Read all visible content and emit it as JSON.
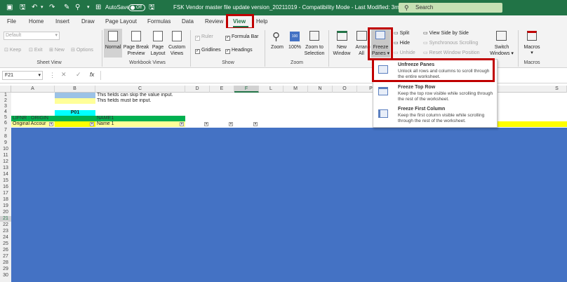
{
  "titlebar": {
    "autosave_label": "AutoSave",
    "autosave_state": "Off",
    "document_title": "FSK Vendor master file update version_20211019  -  Compatibility Mode  -  Last Modified: 3m ago",
    "search_placeholder": "Search",
    "accent_color": "#217346"
  },
  "tabs": [
    "File",
    "Home",
    "Insert",
    "Draw",
    "Page Layout",
    "Formulas",
    "Data",
    "Review",
    "View",
    "Help"
  ],
  "active_tab": "View",
  "ribbon": {
    "sheet_view": {
      "dropdown_value": "Default",
      "keep": "Keep",
      "exit": "Exit",
      "new": "New",
      "options": "Options",
      "label": "Sheet View"
    },
    "workbook_views": {
      "normal": "Normal",
      "page_break_1": "Page Break",
      "page_break_2": "Preview",
      "page_layout_1": "Page",
      "page_layout_2": "Layout",
      "custom_views_1": "Custom",
      "custom_views_2": "Views",
      "label": "Workbook Views"
    },
    "show": {
      "ruler": "Ruler",
      "formula_bar": "Formula Bar",
      "gridlines": "Gridlines",
      "headings": "Headings",
      "label": "Show"
    },
    "zoom": {
      "zoom": "Zoom",
      "hundred": "100%",
      "zoom_to_sel_1": "Zoom to",
      "zoom_to_sel_2": "Selection",
      "label": "Zoom"
    },
    "window": {
      "new_window_1": "New",
      "new_window_2": "Window",
      "arrange_1": "Arrange",
      "arrange_2": "All",
      "freeze_1": "Freeze",
      "freeze_2": "Panes ▾",
      "split": "Split",
      "hide": "Hide",
      "unhide": "Unhide",
      "side_by_side": "View Side by Side",
      "sync_scroll": "Synchronous Scrolling",
      "reset_pos": "Reset Window Position",
      "switch_1": "Switch",
      "switch_2": "Windows ▾"
    },
    "macros": {
      "macros": "Macros",
      "label": "Macros"
    }
  },
  "formula_bar": {
    "name_box": "F21",
    "fx": "fx",
    "content": ""
  },
  "columns": [
    "A",
    "B",
    "C",
    "D",
    "E",
    "F",
    "L",
    "M",
    "N",
    "O",
    "P",
    "S"
  ],
  "rows": [
    "1",
    "2",
    "3",
    "4",
    "5",
    "6",
    "7",
    "8",
    "9",
    "10",
    "11",
    "12",
    "13",
    "14",
    "15",
    "16",
    "17",
    "18",
    "19",
    "20",
    "21",
    "22",
    "23",
    "24",
    "25",
    "26",
    "27",
    "28",
    "29",
    "30"
  ],
  "cells": {
    "c1": "This fields can skip the value input.",
    "c2": "This fields must be input.",
    "b4": "P01",
    "a5": "LIFNR : ORIGIN",
    "c5": "NAME1",
    "a6": "Original Accour",
    "c6": "Name 1"
  },
  "freeze_menu": {
    "items": [
      {
        "title": "Unfreeze Panes",
        "desc": "Unlock all rows and columns to scroll through the entire worksheet."
      },
      {
        "title": "Freeze Top Row",
        "desc": "Keep the top row visible while scrolling through the rest of the worksheet."
      },
      {
        "title": "Freeze First Column",
        "desc": "Keep the first column visible while scrolling through the rest of the worksheet."
      }
    ]
  },
  "colors": {
    "highlight_red": "#c00000",
    "blue_fill": "#4472c4",
    "light_blue": "#9bc2e6",
    "yellow": "#ffff99",
    "cyan": "#00ffff",
    "green_header": "#00b050"
  }
}
